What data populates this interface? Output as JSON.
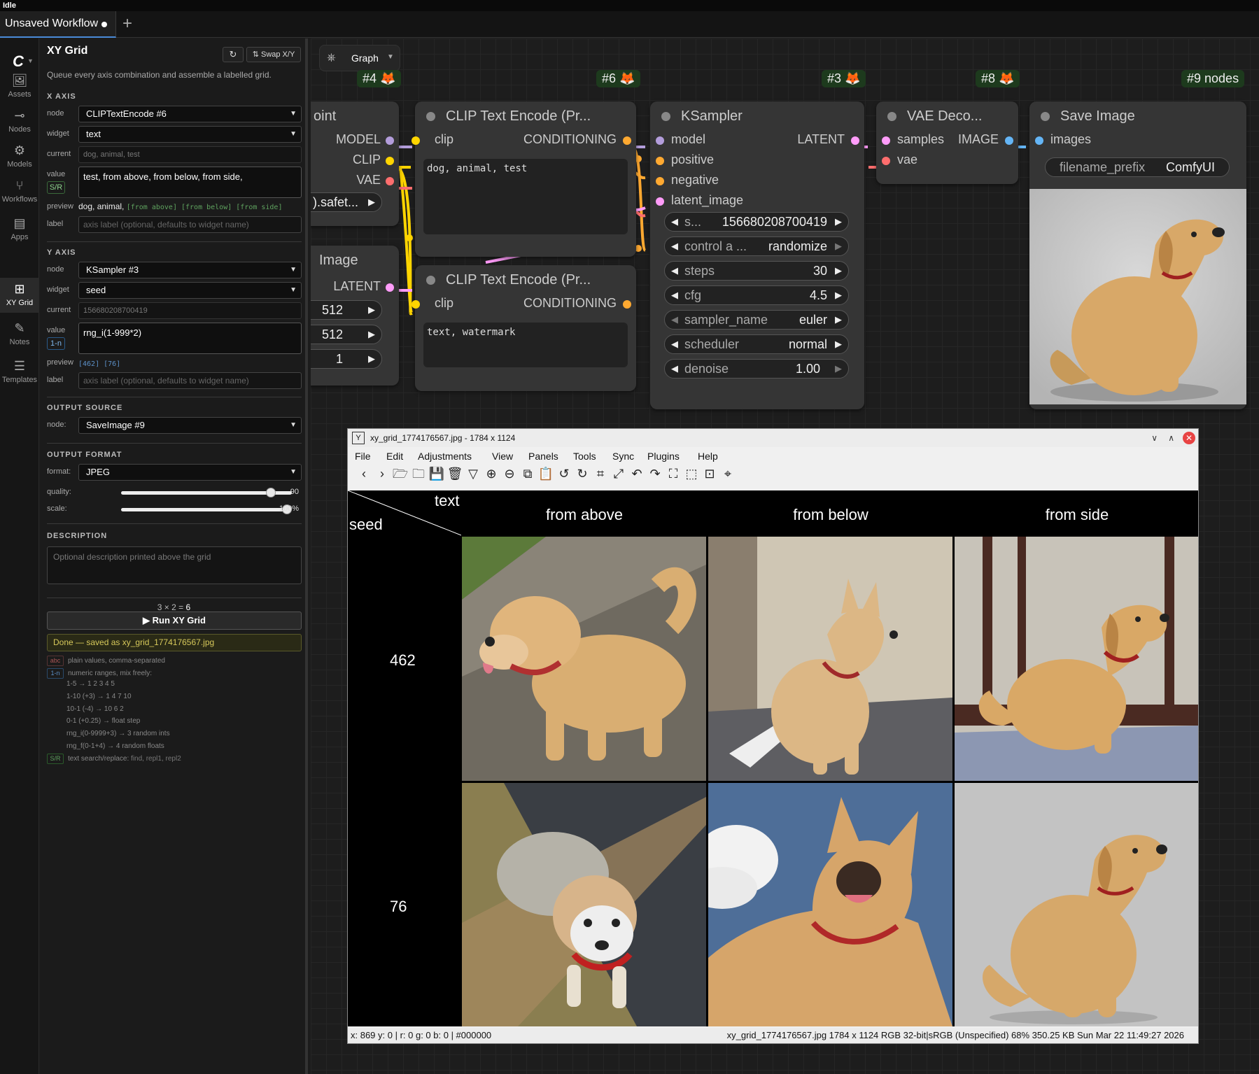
{
  "titlebar": {
    "text": "Idle"
  },
  "tabs": [
    {
      "label": "Unsaved Workflow"
    }
  ],
  "sidebar": {
    "items": [
      {
        "label": "Assets",
        "icon": "image-icon"
      },
      {
        "label": "Nodes",
        "icon": "nodes-icon"
      },
      {
        "label": "Models",
        "icon": "models-icon"
      },
      {
        "label": "Workflows",
        "icon": "workflows-icon"
      },
      {
        "label": "Apps",
        "icon": "apps-icon"
      },
      {
        "label": "XY Grid",
        "icon": "grid-icon"
      },
      {
        "label": "Notes",
        "icon": "notes-icon"
      },
      {
        "label": "Templates",
        "icon": "templates-icon"
      }
    ]
  },
  "panel": {
    "title": "XY Grid",
    "swap_label": "⇅ Swap X/Y",
    "description": "Queue every axis combination and assemble a labelled grid.",
    "x_axis": {
      "heading": "X AXIS",
      "node_label": "node",
      "node": "CLIPTextEncode #6",
      "widget_label": "widget",
      "widget": "text",
      "current_label": "current",
      "current": "dog, animal, test",
      "value_label": "value",
      "value": "test, from above, from below, from side,",
      "mode_badge": "S/R",
      "preview_label": "preview",
      "preview_plain": "dog, animal,",
      "preview_mono": "[from above] [from below] [from side]",
      "label_label": "label",
      "label_placeholder": "axis label (optional, defaults to widget name)"
    },
    "y_axis": {
      "heading": "Y AXIS",
      "node_label": "node",
      "node": "KSampler #3",
      "widget_label": "widget",
      "widget": "seed",
      "current_label": "current",
      "current": "156680208700419",
      "value_label": "value",
      "value": "rng_i(1-999*2)",
      "mode_badge": "1-n",
      "preview_label": "preview",
      "preview_mono": "[462] [76]",
      "label_label": "label",
      "label_placeholder": "axis label (optional, defaults to widget name)"
    },
    "output_source": {
      "heading": "OUTPUT SOURCE",
      "node_label": "node:",
      "node": "SaveImage #9"
    },
    "output_format": {
      "heading": "OUTPUT FORMAT",
      "format_label": "format:",
      "format": "JPEG",
      "quality_label": "quality:",
      "quality": "90",
      "quality_fraction": 0.9,
      "scale_label": "scale:",
      "scale": "100%",
      "scale_fraction": 1.0
    },
    "description_section": {
      "heading": "DESCRIPTION",
      "placeholder": "Optional description printed above the grid"
    },
    "combo": {
      "a": "3",
      "b": "2",
      "total": "6"
    },
    "run_label": "▶ Run XY Grid",
    "status": "Done — saved as xy_grid_1774176567.jpg",
    "help": [
      {
        "badge": "abc",
        "text": "plain values, comma-separated"
      },
      {
        "badge": "1-n",
        "text": "numeric ranges, mix freely:"
      },
      {
        "text": "1-5 → 1 2 3 4 5"
      },
      {
        "text": "1-10 (+3) → 1 4 7 10"
      },
      {
        "text": "10-1 (-4) → 10 6 2"
      },
      {
        "text": "0-1 (+0.25) → float step"
      },
      {
        "text": "rng_i(0-9999+3) → 3 random ints"
      },
      {
        "text": "rng_f(0-1+4) → 4 random floats"
      },
      {
        "badge": "S/R",
        "text": "text search/replace:",
        "extra": "find, repl1, repl2"
      }
    ]
  },
  "graph": {
    "mode_label": "Graph",
    "badges": {
      "n4": "#4 🦊",
      "n6": "#6 🦊",
      "n3": "#3 🦊",
      "n8": "#8 🦊",
      "n9": "#9 nodes"
    },
    "checkpoint": {
      "title": "oint",
      "outs": [
        "MODEL",
        "CLIP",
        "VAE"
      ],
      "widget": ").safet..."
    },
    "latent_image": {
      "title": "Image",
      "out": "LATENT",
      "widgets": [
        "512",
        "512",
        "1"
      ]
    },
    "clip1": {
      "title": "CLIP Text Encode (Pr...",
      "in": "clip",
      "out": "CONDITIONING",
      "text": "dog, animal, test"
    },
    "clip2": {
      "title": "CLIP Text Encode (Pr...",
      "in": "clip",
      "out": "CONDITIONING",
      "text": "text, watermark"
    },
    "ksampler": {
      "title": "KSampler",
      "ins": [
        "model",
        "positive",
        "negative",
        "latent_image"
      ],
      "out": "LATENT",
      "widgets": [
        {
          "label": "s...",
          "value": "156680208700419"
        },
        {
          "label": "control a ...",
          "value": "randomize"
        },
        {
          "label": "steps",
          "value": "30"
        },
        {
          "label": "cfg",
          "value": "4.5"
        },
        {
          "label": "sampler_name",
          "value": "euler"
        },
        {
          "label": "scheduler",
          "value": "normal"
        },
        {
          "label": "denoise",
          "value": "1.00"
        }
      ]
    },
    "vae": {
      "title": "VAE Deco...",
      "ins": [
        "samples",
        "vae"
      ],
      "out": "IMAGE"
    },
    "save": {
      "title": "Save Image",
      "in": "images",
      "prefix_label": "filename_prefix",
      "prefix": "ComfyUI"
    }
  },
  "viewer": {
    "title": "xy_grid_1774176567.jpg - 1784 x 1124",
    "menu": [
      "File",
      "Edit",
      "Adjustments",
      "View",
      "Panels",
      "Tools",
      "Sync",
      "Plugins",
      "Help"
    ],
    "grid": {
      "x_axis_label": "text",
      "y_axis_label": "seed",
      "columns": [
        "from above",
        "from below",
        "from side"
      ],
      "rows": [
        "462",
        "76"
      ]
    },
    "status_left": "x: 869 y: 0 | r: 0 g: 0 b: 0 | #000000",
    "status_right": "xy_grid_1774176567.jpg  1784 x 1124  RGB 32-bit|sRGB (Unspecified)  68%  350.25 KB  Sun Mar 22 11:49:27 2026"
  },
  "colors": {
    "accent": "#4a8ad8",
    "clip_port": "#ffd500",
    "model_port": "#b39ddb",
    "vae_port": "#ff6e6e",
    "latent_port": "#ff9cf9",
    "cond_port": "#ffa931",
    "image_port": "#64b5f6"
  }
}
